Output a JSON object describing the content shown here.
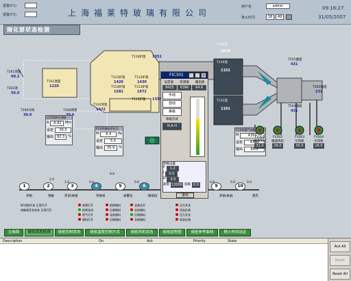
{
  "header": {
    "title": "上海福莱特玻璃有限公司",
    "left_label_1": "报警(F1)",
    "left_label_2": "报警(F2)",
    "user_label": "用户名",
    "user_value": "admin",
    "shift_label": "换火时间",
    "shift_h": "18",
    "shift_m": "49",
    "time": "09:16:27",
    "date": "31/05/2007"
  },
  "section_title": "熔化部状态检测",
  "readouts": [
    {
      "id": "t201",
      "tag": "T201顶温",
      "val": "99.2"
    },
    {
      "id": "t202",
      "tag": "T202温",
      "val": "56.0"
    },
    {
      "id": "t200",
      "tag": "T200冷风",
      "val": "30.0"
    },
    {
      "id": "t101",
      "tag": "T101温度",
      "val": "1220"
    },
    {
      "id": "t100",
      "tag": "T100风管",
      "val": "30.0"
    },
    {
      "id": "t110",
      "tag": "T110炉温",
      "val": "1351"
    },
    {
      "id": "t111",
      "tag": "T111炉温",
      "val": "1420"
    },
    {
      "id": "t112",
      "tag": "T112炉温",
      "val": "1430"
    },
    {
      "id": "t114",
      "tag": "T114炉温",
      "val": "1581"
    },
    {
      "id": "t113",
      "tag": "T113炉温",
      "val": "1672"
    },
    {
      "id": "t115",
      "tag": "T115炉温",
      "val": "1356"
    },
    {
      "id": "t120",
      "tag": "T120顶温",
      "val": "1422"
    },
    {
      "id": "t130",
      "tag": "T130温",
      "val": "1151"
    },
    {
      "id": "t131",
      "tag": "T131温",
      "val": "1161"
    },
    {
      "id": "t132",
      "tag": "T132温",
      "val": "1058"
    },
    {
      "id": "t501",
      "tag": "T501烟道",
      "val": "431"
    },
    {
      "id": "t502",
      "tag": "T502烟道",
      "val": "231"
    },
    {
      "id": "t503",
      "tag": "T503烟道",
      "val": "431"
    }
  ],
  "panel_left": {
    "title": "L1250炉压控制",
    "rows": [
      {
        "k": "A",
        "v": "-6.82",
        "u": "Mm"
      },
      {
        "k": "设定",
        "v": "30.0",
        "u": ""
      },
      {
        "k": "输出",
        "v": "82.3",
        "u": "%"
      }
    ]
  },
  "panel_mid": {
    "title": "P1300熔化炉压力",
    "rows": [
      {
        "k": "M",
        "v": "6.4",
        "u": "Pa"
      },
      {
        "k": "设定",
        "v": "5.5",
        "u": ""
      },
      {
        "k": "输出",
        "v": "35.9",
        "u": "%"
      }
    ]
  },
  "panel_right": {
    "title": "F1300煤气流量控制",
    "rows": [
      {
        "k": "M",
        "v": "4350",
        "u": ""
      },
      {
        "k": "设定",
        "v": "4350",
        "u": ""
      },
      {
        "k": "输出",
        "v": "64.6",
        "u": ""
      }
    ]
  },
  "popup": {
    "title": "FIC301",
    "head": [
      "设定值",
      "检测值",
      "输出值"
    ],
    "values": [
      "8425",
      "6396",
      "64.6"
    ],
    "modes": [
      "手动",
      "自动",
      "串级",
      "串级方式"
    ],
    "mode_value": "N.A.H",
    "params_title": "参数设置",
    "params": [
      {
        "k": "P",
        "v": "1.2"
      },
      {
        "k": "I",
        "v": "0.0"
      },
      {
        "k": "D",
        "v": "0.0"
      },
      {
        "k": "高限",
        "v": "12000"
      },
      {
        "k": "低限",
        "v": "0.0"
      }
    ],
    "close_label": "退出",
    "bar_value": 64.6
  },
  "fans": [
    {
      "name": "FV301",
      "label": "烟道风机",
      "val": "31.0"
    },
    {
      "name": "FV302",
      "label": "烟道风机",
      "val": "26.0"
    },
    {
      "name": "FV303",
      "label": "引风机",
      "val": "35.0"
    },
    {
      "name": "FV304",
      "label": "引风机",
      "val": "26.0"
    }
  ],
  "steps": [
    {
      "n": "1",
      "label": "开始"
    },
    {
      "n": "2",
      "label": "预备"
    },
    {
      "n": "3",
      "label": "开旧/关缝"
    },
    {
      "n": "4",
      "label": "开依扣"
    },
    {
      "n": "5",
      "label": "关雾化"
    },
    {
      "n": "6",
      "label": "换尿段"
    },
    {
      "n": "7",
      "label": ""
    },
    {
      "n": "8",
      "label": ""
    },
    {
      "n": "9",
      "label": "开依/关弱"
    },
    {
      "n": "10",
      "label": "熄灭"
    }
  ],
  "step_times": [
    "2.0",
    "1.0",
    "0.0",
    "0.0",
    "0.0",
    "0.0",
    "0.0",
    "0.0"
  ],
  "status_groups": [
    {
      "items": [
        "BC控制开关",
        "电磁阀开关状态"
      ],
      "states": [
        "正常打开",
        "正常打开"
      ]
    },
    {
      "items": [
        "前缘打开",
        "前缘关闭",
        "喷气打开",
        "燃料打开"
      ],
      "states": [
        "",
        "",
        "",
        ""
      ]
    },
    {
      "items": [
        "前缘燃料",
        "后缘燃料",
        "北前燃料",
        "后缘燃料"
      ],
      "states": [
        "",
        "",
        "",
        ""
      ]
    },
    {
      "items": [
        "北南化开",
        "北前燃料",
        "后缘燃料",
        "北缘燃料"
      ],
      "states": [
        "",
        "",
        "",
        ""
      ]
    },
    {
      "items": [
        "压力开关",
        "状态反馈",
        "压力开关",
        "状态反馈"
      ],
      "states": [
        "",
        "",
        "",
        ""
      ]
    }
  ],
  "tabs": [
    "主画面",
    "熔化状态检测",
    "熔窑控制状态",
    "熔窑温度控制方式",
    "熔窑风机状态",
    "熔窑趋势图",
    "熔窑参考曲线",
    "换火时间设定"
  ],
  "alarm": {
    "cols": [
      "Description",
      "On",
      "Ack",
      "Priority",
      "State"
    ],
    "buttons": [
      "Ack All",
      "Reset",
      "Reset All"
    ]
  }
}
